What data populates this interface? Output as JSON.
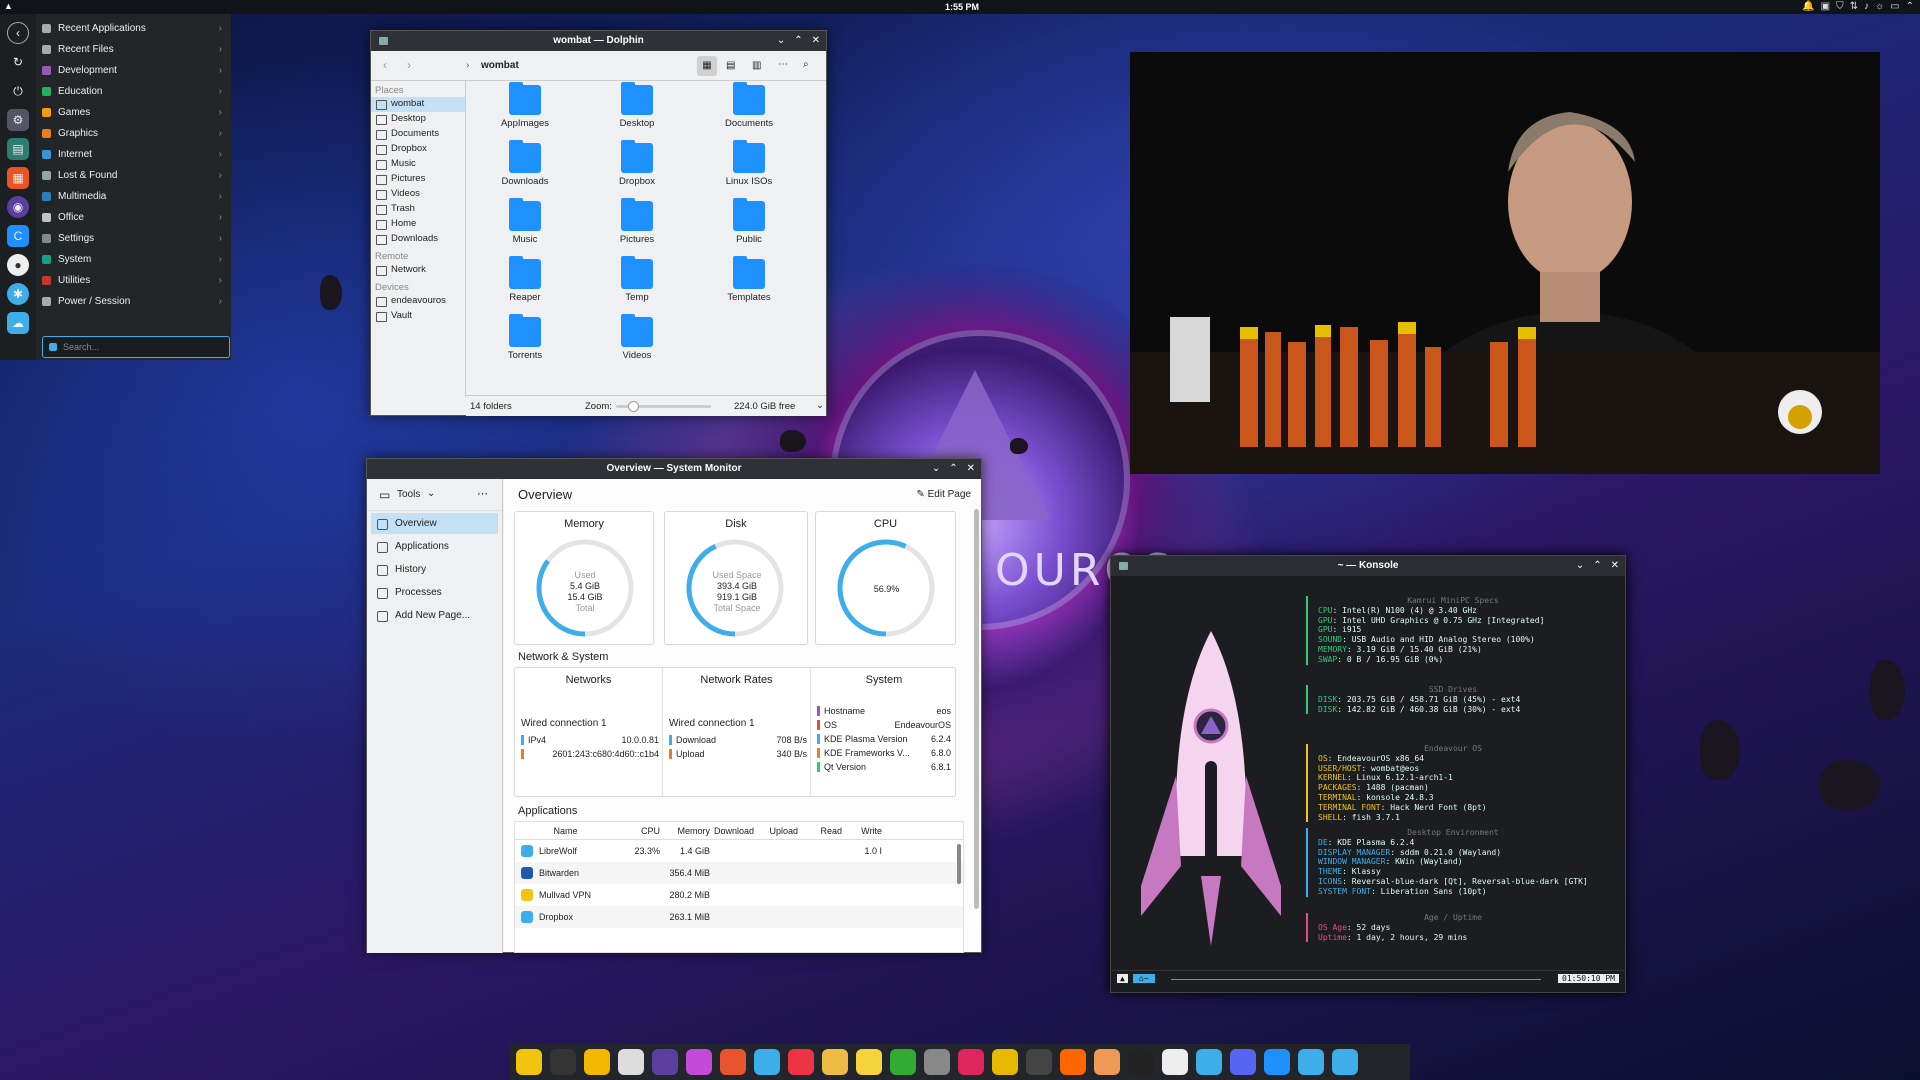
{
  "topbar": {
    "clock": "1:55 PM"
  },
  "launcher": {
    "items": [
      {
        "label": "Recent Applications",
        "color": "#aaa"
      },
      {
        "label": "Recent Files",
        "color": "#aaa"
      },
      {
        "label": "Development",
        "color": "#9b59b6"
      },
      {
        "label": "Education",
        "color": "#27ae60"
      },
      {
        "label": "Games",
        "color": "#f39c12"
      },
      {
        "label": "Graphics",
        "color": "#e67e22"
      },
      {
        "label": "Internet",
        "color": "#3498db"
      },
      {
        "label": "Lost & Found",
        "color": "#95a5a6"
      },
      {
        "label": "Multimedia",
        "color": "#2980b9"
      },
      {
        "label": "Office",
        "color": "#bdc3c7"
      },
      {
        "label": "Settings",
        "color": "#7f8c8d"
      },
      {
        "label": "System",
        "color": "#16a085"
      },
      {
        "label": "Utilities",
        "color": "#c0392b"
      },
      {
        "label": "Power / Session",
        "color": "#aaa"
      }
    ],
    "search_placeholder": "Search..."
  },
  "dolphin": {
    "title": "wombat — Dolphin",
    "path": "wombat",
    "places_header": "Places",
    "places": [
      "wombat",
      "Desktop",
      "Documents",
      "Dropbox",
      "Music",
      "Pictures",
      "Videos",
      "Trash",
      "Home",
      "Downloads"
    ],
    "remote_header": "Remote",
    "remote": [
      "Network"
    ],
    "devices_header": "Devices",
    "devices": [
      "endeavouros",
      "Vault"
    ],
    "folders": [
      "AppImages",
      "Desktop",
      "Documents",
      "Downloads",
      "Dropbox",
      "Linux ISOs",
      "Music",
      "Pictures",
      "Public",
      "Reaper",
      "Temp",
      "Templates",
      "Torrents",
      "Videos"
    ],
    "status": "14 folders",
    "zoom_label": "Zoom:",
    "free": "224.0 GiB free"
  },
  "sysmon": {
    "title": "Overview — System Monitor",
    "tools": "Tools",
    "page_title": "Overview",
    "edit_page": "Edit Page",
    "nav": [
      "Overview",
      "Applications",
      "History",
      "Processes",
      "Add New Page..."
    ],
    "memory": {
      "title": "Memory",
      "used_label": "Used",
      "used": "5.4 GiB",
      "total": "15.4 GiB",
      "total_label": "Total",
      "fraction": 0.35
    },
    "disk": {
      "title": "Disk",
      "used_label": "Used Space",
      "used": "393.4 GiB",
      "total": "919.1 GiB",
      "total_label": "Total Space",
      "fraction": 0.43
    },
    "cpu": {
      "title": "CPU",
      "value": "56.9%",
      "fraction": 0.569
    },
    "net_section": "Network & System",
    "networks": {
      "title": "Networks",
      "conn": "Wired connection 1",
      "ipv4_label": "IPv4",
      "ipv4": "10.0.0.81",
      "ipv6": "2601:243:c680:4d60::c1b4"
    },
    "rates": {
      "title": "Network Rates",
      "conn": "Wired connection 1",
      "download_label": "Download",
      "download": "708 B/s",
      "upload_label": "Upload",
      "upload": "340 B/s"
    },
    "system": {
      "title": "System",
      "rows": [
        [
          "Hostname",
          "eos"
        ],
        [
          "OS",
          "EndeavourOS"
        ],
        [
          "KDE Plasma Version",
          "6.2.4"
        ],
        [
          "KDE Frameworks V...",
          "6.8.0"
        ],
        [
          "Qt Version",
          "6.8.1"
        ]
      ]
    },
    "apps_section": "Applications",
    "columns": [
      "Name",
      "CPU",
      "Memory",
      "Download",
      "Upload",
      "Read",
      "Write"
    ],
    "apps": [
      {
        "name": "LibreWolf",
        "cpu": "23.3%",
        "mem": "1.4 GiB",
        "write": "1.0 I"
      },
      {
        "name": "Bitwarden",
        "cpu": "",
        "mem": "356.4 MiB",
        "write": ""
      },
      {
        "name": "Mullvad VPN",
        "cpu": "",
        "mem": "280.2 MiB",
        "write": ""
      },
      {
        "name": "Dropbox",
        "cpu": "",
        "mem": "263.1 MiB",
        "write": ""
      }
    ]
  },
  "konsole": {
    "title": "~ — Konsole",
    "blocks": [
      {
        "title": "Kamrui MiniPC Specs",
        "color": "#2ecc71",
        "lines": [
          [
            "CPU",
            "Intel(R) N100 (4) @ 3.40 GHz"
          ],
          [
            "GPU",
            "Intel UHD Graphics @ 0.75 GHz [Integrated]"
          ],
          [
            "GPU",
            "i915"
          ],
          [
            "SOUND",
            "USB Audio and HID Analog Stereo (100%)"
          ],
          [
            "MEMORY",
            "3.19 GiB / 15.40 GiB (21%)"
          ],
          [
            "SWAP",
            "0 B / 16.95 GiB (0%)"
          ]
        ]
      },
      {
        "title": "SSD Drives",
        "color": "#2ecc71",
        "lines": [
          [
            "DISK",
            "203.75 GiB / 458.71 GiB (45%) - ext4"
          ],
          [
            "DISK",
            "142.82 GiB / 460.38 GiB (30%) - ext4"
          ]
        ]
      },
      {
        "title": "Endeavour OS",
        "color": "#f1c40f",
        "lines": [
          [
            "OS",
            "EndeavourOS x86_64"
          ],
          [
            "USER/HOST",
            "wombat@eos"
          ],
          [
            "KERNEL",
            "Linux 6.12.1-arch1-1"
          ],
          [
            "PACKAGES",
            "1488 (pacman)"
          ],
          [
            "TERMINAL",
            "konsole 24.8.3"
          ],
          [
            "TERMINAL FONT",
            "Hack Nerd Font (8pt)"
          ],
          [
            "SHELL",
            "fish 3.7.1"
          ]
        ]
      },
      {
        "title": "Desktop Environment",
        "color": "#3daee9",
        "lines": [
          [
            "DE",
            "KDE Plasma 6.2.4"
          ],
          [
            "DISPLAY MANAGER",
            "sddm 0.21.0 (Wayland)"
          ],
          [
            "WINDOW MANAGER",
            "KWin (Wayland)"
          ],
          [
            "THEME",
            "Klassy"
          ],
          [
            "ICONS",
            "Reversal-blue-dark [Qt], Reversal-blue-dark [GTK]"
          ],
          [
            "SYSTEM FONT",
            "Liberation Sans (10pt)"
          ]
        ]
      },
      {
        "title": "Age / Uptime",
        "color": "#e74c8c",
        "lines": [
          [
            "OS Age",
            "52 days"
          ],
          [
            "Uptime",
            "1 day, 2 hours, 29 mins"
          ]
        ]
      }
    ],
    "prompt_time": "01:50:10 PM"
  },
  "dock": {
    "icons": [
      "files",
      "terminal",
      "notes",
      "text-editor",
      "browser-tor",
      "palette",
      "fox",
      "globe",
      "media",
      "chrome",
      "sticky",
      "xbox",
      "shield",
      "target",
      "coin",
      "film",
      "chat",
      "discord-alt",
      "steam",
      "download",
      "web",
      "discord",
      "folder-blue",
      "librewolf",
      "activity"
    ]
  }
}
